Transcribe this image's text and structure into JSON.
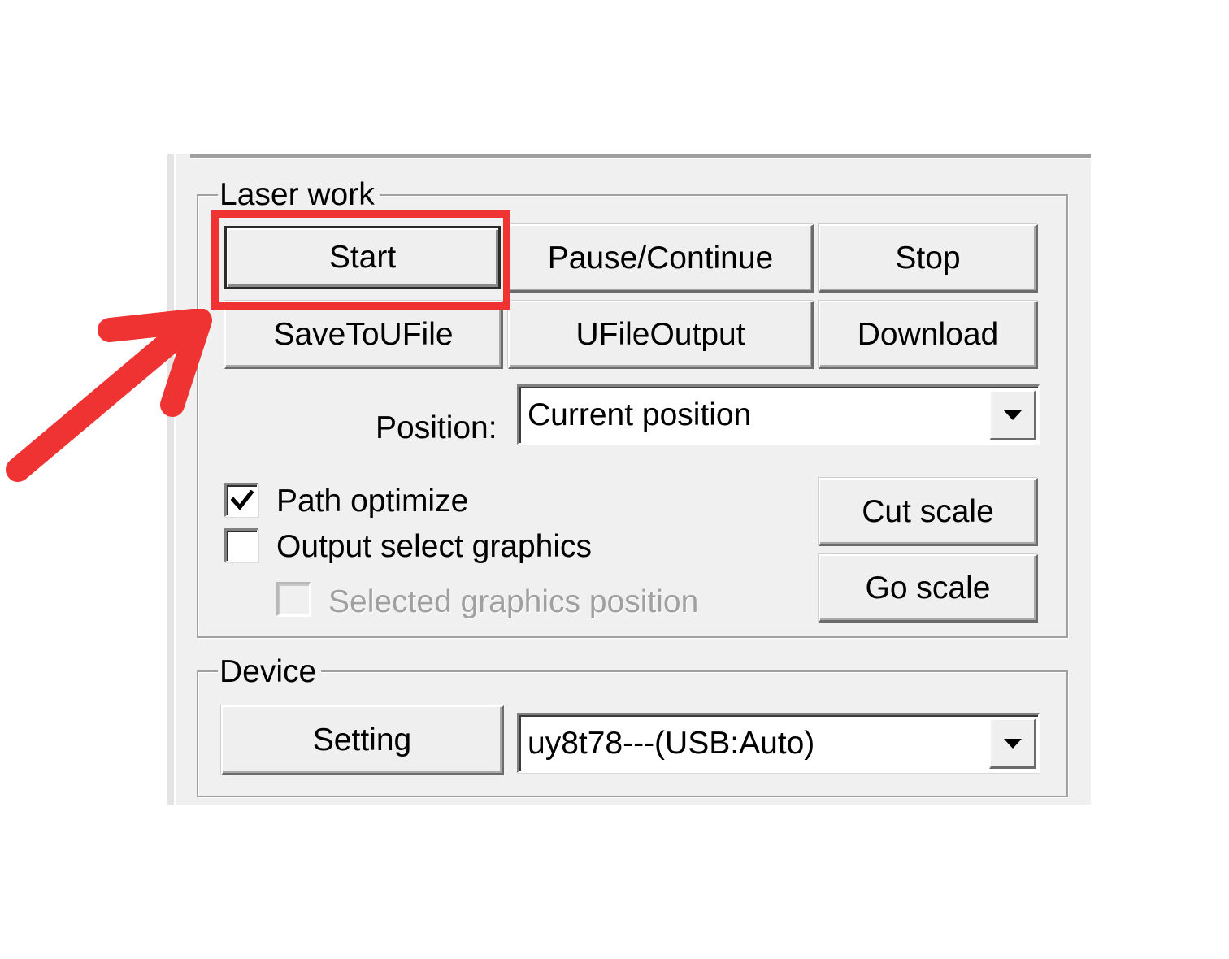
{
  "laser_work": {
    "title": "Laser work",
    "buttons": {
      "start": "Start",
      "pause_continue": "Pause/Continue",
      "stop": "Stop",
      "save_to_ufile": "SaveToUFile",
      "ufile_output": "UFileOutput",
      "download": "Download",
      "cut_scale": "Cut scale",
      "go_scale": "Go scale"
    },
    "position": {
      "label": "Position:",
      "value": "Current position"
    },
    "options": {
      "path_optimize": {
        "label": "Path optimize",
        "checked": true,
        "enabled": true
      },
      "output_select_graphics": {
        "label": "Output select graphics",
        "checked": false,
        "enabled": true
      },
      "selected_graphics_position": {
        "label": "Selected graphics position",
        "checked": false,
        "enabled": false
      }
    }
  },
  "device": {
    "title": "Device",
    "setting_button": "Setting",
    "selected_device": "uy8t78---(USB:Auto)"
  },
  "annotation": {
    "color": "#ef3232",
    "highlight_target": "Start",
    "pointer": "arrow"
  },
  "icons": {
    "dropdown": "chevron-down-icon",
    "check": "checkmark-icon",
    "pointer": "arrow-icon"
  }
}
